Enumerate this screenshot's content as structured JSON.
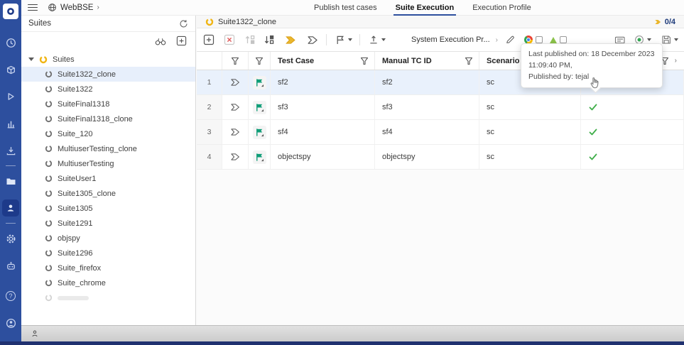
{
  "colors": {
    "accent": "#2d4f9e",
    "selection": "#e9f1fc",
    "suite_yellow": "#eab62c",
    "check_green": "#3fae49",
    "flag_teal": "#0f9d77"
  },
  "topbar": {
    "app_name": "WebBSE",
    "breadcrumb_chevron": "›",
    "tabs": [
      {
        "label": "Publish test cases",
        "active": false
      },
      {
        "label": "Suite Execution",
        "active": true
      },
      {
        "label": "Execution Profile",
        "active": false
      }
    ]
  },
  "suites_panel": {
    "title": "Suites",
    "root_label": "Suites",
    "items": [
      {
        "label": "Suite1322_clone",
        "selected": true
      },
      {
        "label": "Suite1322"
      },
      {
        "label": "SuiteFinal1318"
      },
      {
        "label": "SuiteFinal1318_clone"
      },
      {
        "label": "Suite_120"
      },
      {
        "label": "MultiuserTesting_clone"
      },
      {
        "label": "MultiuserTesting"
      },
      {
        "label": "SuiteUser1"
      },
      {
        "label": "Suite1305_clone"
      },
      {
        "label": "Suite1305"
      },
      {
        "label": "Suite1291"
      },
      {
        "label": "objspy"
      },
      {
        "label": "Suite1296"
      },
      {
        "label": "Suite_firefox"
      },
      {
        "label": "Suite_chrome"
      },
      {
        "label": "",
        "truncated": true
      }
    ]
  },
  "main": {
    "suite_tab_label": "Suite1322_clone",
    "run_counter": "0/4",
    "toolbar": {
      "profile_label": "System Execution Pr...",
      "profile_chevron": "›"
    },
    "table": {
      "headers": {
        "test_case": "Test Case",
        "manual_tc_id": "Manual TC ID",
        "scenario": "Scenario"
      },
      "rows": [
        {
          "num": "1",
          "test_case": "sf2",
          "manual_tc_id": "sf2",
          "scenario": "sc",
          "status": ""
        },
        {
          "num": "2",
          "test_case": "sf3",
          "manual_tc_id": "sf3",
          "scenario": "sc",
          "status": "passed"
        },
        {
          "num": "3",
          "test_case": "sf4",
          "manual_tc_id": "sf4",
          "scenario": "sc",
          "status": "passed"
        },
        {
          "num": "4",
          "test_case": "objectspy",
          "manual_tc_id": "objectspy",
          "scenario": "sc",
          "status": "passed"
        }
      ]
    },
    "tooltip": {
      "line1": "Last published on: 18 December 2023",
      "line2": "11:09:40 PM,",
      "line3": "Published by: tejal"
    },
    "help_glyph": "?"
  }
}
